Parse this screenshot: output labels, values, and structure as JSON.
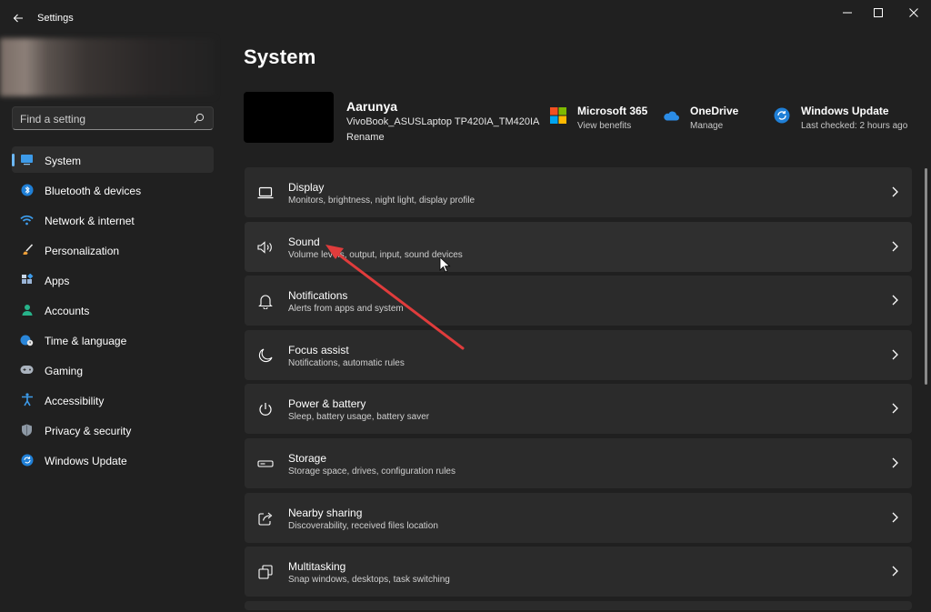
{
  "window": {
    "title": "Settings"
  },
  "search": {
    "placeholder": "Find a setting"
  },
  "sidebar": {
    "items": [
      {
        "label": "System",
        "icon": "monitor-icon",
        "active": true
      },
      {
        "label": "Bluetooth & devices",
        "icon": "bluetooth-icon"
      },
      {
        "label": "Network & internet",
        "icon": "wifi-icon"
      },
      {
        "label": "Personalization",
        "icon": "brush-icon"
      },
      {
        "label": "Apps",
        "icon": "apps-icon"
      },
      {
        "label": "Accounts",
        "icon": "person-icon"
      },
      {
        "label": "Time & language",
        "icon": "globe-clock-icon"
      },
      {
        "label": "Gaming",
        "icon": "gamepad-icon"
      },
      {
        "label": "Accessibility",
        "icon": "accessibility-icon"
      },
      {
        "label": "Privacy & security",
        "icon": "shield-icon"
      },
      {
        "label": "Windows Update",
        "icon": "update-icon"
      }
    ]
  },
  "main": {
    "title": "System",
    "device": {
      "user": "Aarunya",
      "name": "VivoBook_ASUSLaptop TP420IA_TM420IA",
      "rename": "Rename"
    },
    "quick_links": [
      {
        "title": "Microsoft 365",
        "subtitle": "View benefits",
        "icon": "microsoft-logo-icon"
      },
      {
        "title": "OneDrive",
        "subtitle": "Manage",
        "icon": "onedrive-cloud-icon"
      },
      {
        "title": "Windows Update",
        "subtitle": "Last checked: 2 hours ago",
        "icon": "sync-icon"
      }
    ],
    "cards": [
      {
        "title": "Display",
        "subtitle": "Monitors, brightness, night light, display profile",
        "icon": "laptop-icon"
      },
      {
        "title": "Sound",
        "subtitle": "Volume levels, output, input, sound devices",
        "icon": "speaker-icon"
      },
      {
        "title": "Notifications",
        "subtitle": "Alerts from apps and system",
        "icon": "bell-icon"
      },
      {
        "title": "Focus assist",
        "subtitle": "Notifications, automatic rules",
        "icon": "moon-icon"
      },
      {
        "title": "Power & battery",
        "subtitle": "Sleep, battery usage, battery saver",
        "icon": "power-icon"
      },
      {
        "title": "Storage",
        "subtitle": "Storage space, drives, configuration rules",
        "icon": "storage-icon"
      },
      {
        "title": "Nearby sharing",
        "subtitle": "Discoverability, received files location",
        "icon": "share-icon"
      },
      {
        "title": "Multitasking",
        "subtitle": "Snap windows, desktops, task switching",
        "icon": "multitask-icon"
      }
    ]
  },
  "colors": {
    "background": "#202020",
    "card": "#2b2b2b",
    "accent": "#6cb8f6",
    "annotation_arrow": "#e03c3c"
  }
}
